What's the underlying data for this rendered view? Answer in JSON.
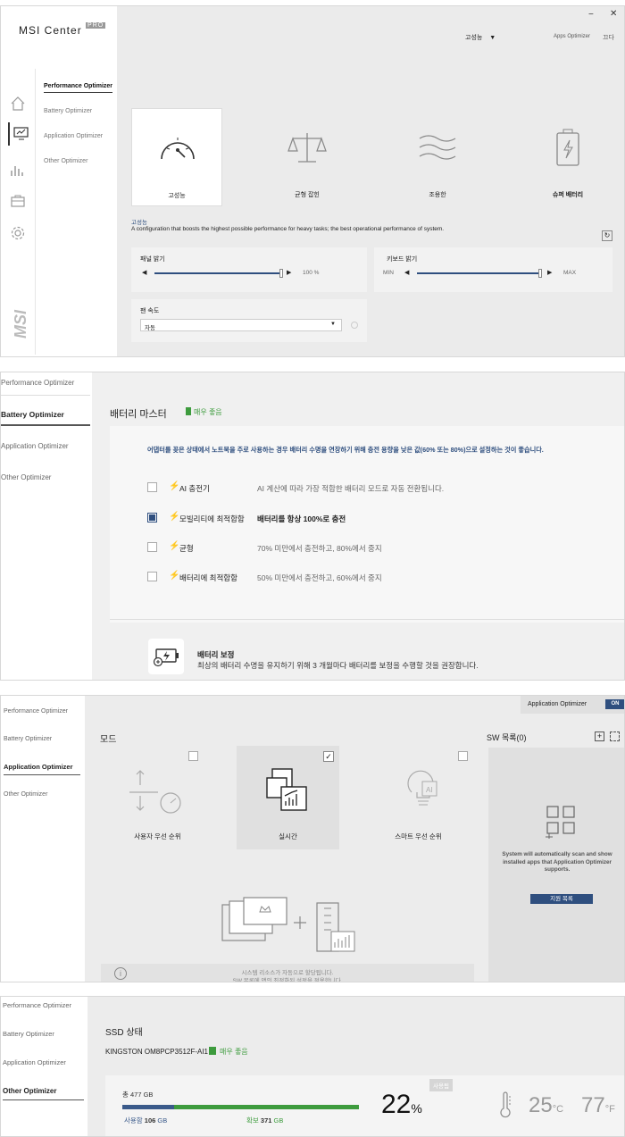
{
  "panel1": {
    "logo_text": "MSI Center",
    "logo_pro": "PRO",
    "user": "고성능",
    "apps_optimizer": "Apps Optimizer",
    "close_text": "끄다",
    "nav": [
      "Performance Optimizer",
      "Battery Optimizer",
      "Application Optimizer",
      "Other Optimizer"
    ],
    "modes": [
      "고성능",
      "균형 잡힌",
      "조용한",
      "슈퍼 배터리"
    ],
    "selected_mode": "고성능",
    "mode_desc": "A configuration that boosts the highest possible performance for heavy tasks; the best operational performance of system.",
    "panel_brightness": {
      "label": "패널 밝기",
      "value": "100 %",
      "level": 1.0
    },
    "keyboard_brightness": {
      "label": "키보드 밝기",
      "min": "MIN",
      "max": "MAX",
      "level": 1.0
    },
    "fan_speed": {
      "label": "팬 속도",
      "value": "자동"
    }
  },
  "panel2": {
    "nav": [
      "Performance Optimizer",
      "Battery Optimizer",
      "Application Optimizer",
      "Other Optimizer"
    ],
    "title": "배터리 마스터",
    "status": "매우 좋음",
    "info": "어댑터를 꽂은 상태에서 노트북을 주로 사용하는 경우 배터리 수명을 연장하기 위해 충전 용량을 낮은 값(60% 또는 80%)으로 설정하는 것이 좋습니다.",
    "options": [
      {
        "label": "AI 충전기",
        "desc": "AI 계산에 따라 가장 적합한 배터리 모드로 자동 전환됩니다.",
        "checked": false,
        "bolt_color": "#e8531f"
      },
      {
        "label": "모빌리티에 최적합함",
        "desc": "배터리를 항상 100%로 충전",
        "checked": true,
        "bolt_color": "#f0a020"
      },
      {
        "label": "균형",
        "desc": "70% 미만에서 충전하고, 80%에서 중지",
        "checked": false,
        "bolt_color": "#3a8de0"
      },
      {
        "label": "배터리에 최적합함",
        "desc": "50% 미만에서 충전하고, 60%에서 중지",
        "checked": false,
        "bolt_color": "#46b840"
      }
    ],
    "calibration_title": "배터리 보정",
    "calibration_desc": "최상의 배터리 수명을 유지하기 위해 3 개월마다 배터리를 보정을 수행할 것을 권장합니다."
  },
  "panel3": {
    "nav": [
      "Performance Optimizer",
      "Battery Optimizer",
      "Application Optimizer",
      "Other Optimizer"
    ],
    "header_label": "Application Optimizer",
    "toggle": "ON",
    "mode_title": "모드",
    "modes": [
      {
        "label": "사용자 우선 순위",
        "checked": false
      },
      {
        "label": "실시간",
        "checked": true
      },
      {
        "label": "스마트 우선 순위",
        "checked": false
      }
    ],
    "sw_title": "SW 목록(0)",
    "sw_text": "System will automatically scan and show installed apps that Application Optimizer supports.",
    "sw_button": "지원 목록",
    "bottom_line1": "시스템 리소스가 자동으로 할당됩니다.",
    "bottom_line2": "SW 목록에 앱의 최적화된 설정을 적용합니다."
  },
  "panel4": {
    "nav": [
      "Performance Optimizer",
      "Battery Optimizer",
      "Application Optimizer",
      "Other Optimizer"
    ],
    "title": "SSD 상태",
    "device": "KINGSTON OM8PCP3512F-AI1",
    "status": "매우 좋음",
    "total": "총 477 GB",
    "used_label": "사용함",
    "used_value": "106",
    "free_label": "확보",
    "free_value": "371",
    "unit": "GB",
    "percent": "22",
    "percent_sign": "%",
    "usage_tag": "사용됨",
    "used_fraction": 0.22,
    "temp_c": "25",
    "unit_c": "°C",
    "temp_f": "77",
    "unit_f": "°F"
  },
  "colors": {
    "accent": "#2f4f7f",
    "green": "#3d9b3d",
    "bar_used": "#3a5a8a",
    "bar_free": "#3d9b3d"
  }
}
